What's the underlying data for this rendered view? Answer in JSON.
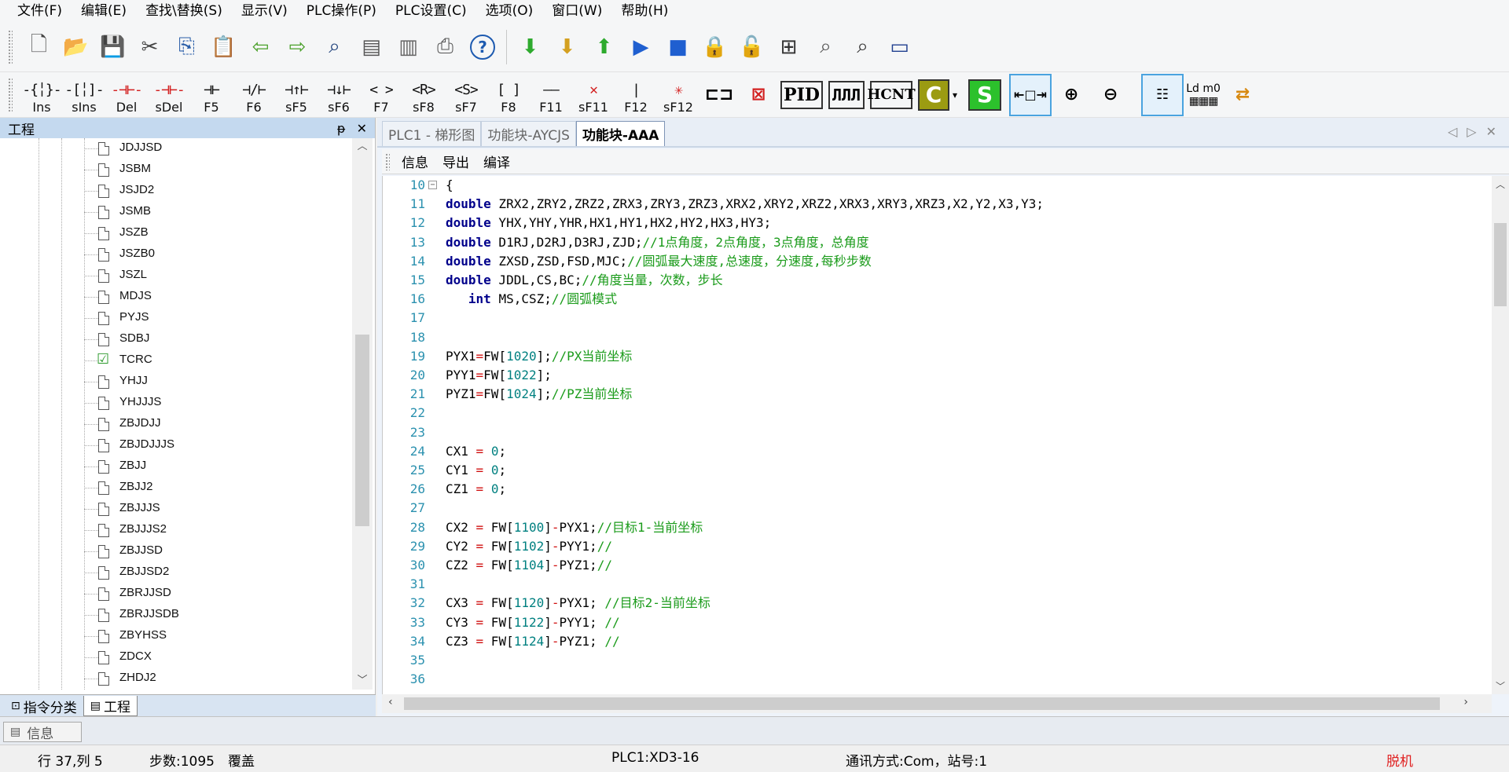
{
  "menu": [
    "文件(F)",
    "编辑(E)",
    "查找\\替换(S)",
    "显示(V)",
    "PLC操作(P)",
    "PLC设置(C)",
    "选项(O)",
    "窗口(W)",
    "帮助(H)"
  ],
  "toolbar_icons": [
    "new-file-icon",
    "open-folder-icon",
    "save-icon",
    "cut-icon",
    "copy-icon",
    "paste-icon",
    "back-arrow-icon",
    "forward-arrow-icon",
    "find-icon",
    "monitor-icon",
    "document-icon",
    "print-icon",
    "help-icon",
    "download-icon",
    "download-lock-icon",
    "upload-icon",
    "run-icon",
    "stop-icon",
    "lock-icon",
    "unlock-icon",
    "io-table-icon",
    "search-table-icon",
    "search-icon",
    "serial-port-icon"
  ],
  "ladder_buttons": [
    {
      "sym": "-{╎}-",
      "label": "Ins"
    },
    {
      "sym": "-[╎]-",
      "label": "sIns"
    },
    {
      "sym": "-⊣⊢-",
      "label": "Del",
      "red": true
    },
    {
      "sym": "-⊣⊢-",
      "label": "sDel",
      "red": true
    },
    {
      "sym": "⊣⊢",
      "label": "F5"
    },
    {
      "sym": "⊣/⊢",
      "label": "F6"
    },
    {
      "sym": "⊣↑⊢",
      "label": "sF5"
    },
    {
      "sym": "⊣↓⊢",
      "label": "sF6"
    },
    {
      "sym": "<  >",
      "label": "F7"
    },
    {
      "sym": "<R>",
      "label": "sF8"
    },
    {
      "sym": "<S>",
      "label": "sF7"
    },
    {
      "sym": "[  ]",
      "label": "F8"
    },
    {
      "sym": "——",
      "label": "F11"
    },
    {
      "sym": "✕",
      "label": "sF11",
      "red": true
    },
    {
      "sym": "|",
      "label": "F12"
    },
    {
      "sym": "✳",
      "label": "sF12",
      "red": true
    }
  ],
  "toolbar2_extra": {
    "pid": "PID",
    "hcnt": "HCNT",
    "c": "C",
    "s": "S",
    "ld": "Ld m0"
  },
  "left_panel": {
    "title": "工程",
    "pin": "ᵽ",
    "close": "✕",
    "tree_items": [
      "JDJJSD",
      "JSBM",
      "JSJD2",
      "JSMB",
      "JSZB",
      "JSZB0",
      "JSZL",
      "MDJS",
      "PYJS",
      "SDBJ",
      "TCRC",
      "YHJJ",
      "YHJJJS",
      "ZBJDJJ",
      "ZBJDJJJS",
      "ZBJJ",
      "ZBJJ2",
      "ZBJJJS",
      "ZBJJJS2",
      "ZBJJSD",
      "ZBJJSD2",
      "ZBRJJSD",
      "ZBRJJSDB",
      "ZBYHSS",
      "ZDCX",
      "ZHDJ2"
    ],
    "checked_item": "TCRC",
    "tabs": [
      "指令分类",
      "工程"
    ]
  },
  "doc_tabs": [
    "PLC1 - 梯形图",
    "功能块-AYCJS",
    "功能块-AAA"
  ],
  "editor_toolbar": [
    "信息",
    "导出",
    "编译"
  ],
  "code_lines": [
    {
      "n": "10",
      "fold": "−",
      "parts": [
        [
          "",
          "{"
        ]
      ]
    },
    {
      "n": "11",
      "parts": [
        [
          "kw",
          "double"
        ],
        [
          "",
          " ZRX2,ZRY2,ZRZ2,ZRX3,ZRY3,ZRZ3,XRX2,XRY2,XRZ2,XRX3,XRY3,XRZ3,X2,Y2,X3,Y3;"
        ]
      ]
    },
    {
      "n": "12",
      "parts": [
        [
          "kw",
          "double"
        ],
        [
          "",
          " YHX,YHY,YHR,HX1,HY1,HX2,HY2,HX3,HY3;"
        ]
      ]
    },
    {
      "n": "13",
      "parts": [
        [
          "kw",
          "double"
        ],
        [
          "",
          " D1RJ,D2RJ,D3RJ,ZJD;"
        ],
        [
          "cm",
          "//1点角度，2点角度，3点角度，总角度"
        ]
      ]
    },
    {
      "n": "14",
      "parts": [
        [
          "kw",
          "double"
        ],
        [
          "",
          " ZXSD,ZSD,FSD,MJC;"
        ],
        [
          "cm",
          "//圆弧最大速度,总速度，分速度,每秒步数"
        ]
      ]
    },
    {
      "n": "15",
      "parts": [
        [
          "kw",
          "double"
        ],
        [
          "",
          " JDDL,CS,BC;"
        ],
        [
          "cm",
          "//角度当量，次数，步长"
        ]
      ]
    },
    {
      "n": "16",
      "parts": [
        [
          "",
          "   "
        ],
        [
          "kw",
          "int"
        ],
        [
          "",
          " MS,CSZ;"
        ],
        [
          "cm",
          "//圆弧模式"
        ]
      ]
    },
    {
      "n": "17",
      "parts": []
    },
    {
      "n": "18",
      "parts": []
    },
    {
      "n": "19",
      "parts": [
        [
          "",
          "PYX1"
        ],
        [
          "op",
          "="
        ],
        [
          "",
          "FW["
        ],
        [
          "num",
          "1020"
        ],
        [
          "",
          "];"
        ],
        [
          "cm",
          "//PX当前坐标"
        ]
      ]
    },
    {
      "n": "20",
      "parts": [
        [
          "",
          "PYY1"
        ],
        [
          "op",
          "="
        ],
        [
          "",
          "FW["
        ],
        [
          "num",
          "1022"
        ],
        [
          "",
          "];"
        ]
      ]
    },
    {
      "n": "21",
      "parts": [
        [
          "",
          "PYZ1"
        ],
        [
          "op",
          "="
        ],
        [
          "",
          "FW["
        ],
        [
          "num",
          "1024"
        ],
        [
          "",
          "];"
        ],
        [
          "cm",
          "//PZ当前坐标"
        ]
      ]
    },
    {
      "n": "22",
      "parts": []
    },
    {
      "n": "23",
      "parts": []
    },
    {
      "n": "24",
      "parts": [
        [
          "",
          "CX1 "
        ],
        [
          "op",
          "="
        ],
        [
          "",
          " "
        ],
        [
          "num",
          "0"
        ],
        [
          "",
          ";"
        ]
      ]
    },
    {
      "n": "25",
      "parts": [
        [
          "",
          "CY1 "
        ],
        [
          "op",
          "="
        ],
        [
          "",
          " "
        ],
        [
          "num",
          "0"
        ],
        [
          "",
          ";"
        ]
      ]
    },
    {
      "n": "26",
      "parts": [
        [
          "",
          "CZ1 "
        ],
        [
          "op",
          "="
        ],
        [
          "",
          " "
        ],
        [
          "num",
          "0"
        ],
        [
          "",
          ";"
        ]
      ]
    },
    {
      "n": "27",
      "parts": []
    },
    {
      "n": "28",
      "parts": [
        [
          "",
          "CX2 "
        ],
        [
          "op",
          "="
        ],
        [
          "",
          " FW["
        ],
        [
          "num",
          "1100"
        ],
        [
          "",
          "]"
        ],
        [
          "op",
          "-"
        ],
        [
          "",
          "PYX1;"
        ],
        [
          "cm",
          "//目标1-当前坐标"
        ]
      ]
    },
    {
      "n": "29",
      "parts": [
        [
          "",
          "CY2 "
        ],
        [
          "op",
          "="
        ],
        [
          "",
          " FW["
        ],
        [
          "num",
          "1102"
        ],
        [
          "",
          "]"
        ],
        [
          "op",
          "-"
        ],
        [
          "",
          "PYY1;"
        ],
        [
          "cm",
          "//"
        ]
      ]
    },
    {
      "n": "30",
      "parts": [
        [
          "",
          "CZ2 "
        ],
        [
          "op",
          "="
        ],
        [
          "",
          " FW["
        ],
        [
          "num",
          "1104"
        ],
        [
          "",
          "]"
        ],
        [
          "op",
          "-"
        ],
        [
          "",
          "PYZ1;"
        ],
        [
          "cm",
          "//"
        ]
      ]
    },
    {
      "n": "31",
      "parts": []
    },
    {
      "n": "32",
      "parts": [
        [
          "",
          "CX3 "
        ],
        [
          "op",
          "="
        ],
        [
          "",
          " FW["
        ],
        [
          "num",
          "1120"
        ],
        [
          "",
          "]"
        ],
        [
          "op",
          "-"
        ],
        [
          "",
          "PYX1; "
        ],
        [
          "cm",
          "//目标2-当前坐标"
        ]
      ]
    },
    {
      "n": "33",
      "parts": [
        [
          "",
          "CY3 "
        ],
        [
          "op",
          "="
        ],
        [
          "",
          " FW["
        ],
        [
          "num",
          "1122"
        ],
        [
          "",
          "]"
        ],
        [
          "op",
          "-"
        ],
        [
          "",
          "PYY1; "
        ],
        [
          "cm",
          "//"
        ]
      ]
    },
    {
      "n": "34",
      "parts": [
        [
          "",
          "CZ3 "
        ],
        [
          "op",
          "="
        ],
        [
          "",
          " FW["
        ],
        [
          "num",
          "1124"
        ],
        [
          "",
          "]"
        ],
        [
          "op",
          "-"
        ],
        [
          "",
          "PYZ1; "
        ],
        [
          "cm",
          "//"
        ]
      ]
    },
    {
      "n": "35",
      "parts": []
    },
    {
      "n": "36",
      "parts": []
    }
  ],
  "bottom": {
    "info_tab": "信息"
  },
  "status": {
    "position": "行 37,列 5",
    "steps": "步数:1095",
    "mode": "覆盖",
    "plc": "PLC1:XD3-16",
    "comm": "通讯方式:Com，站号:1",
    "state": "脱机"
  },
  "colors": {
    "keyword": "#00008b",
    "comment": "#1a9b1a",
    "number": "#008080",
    "operator": "#d01010",
    "line_number": "#2b91af",
    "offline": "#e02020",
    "panel_header": "#c4d9ef"
  }
}
